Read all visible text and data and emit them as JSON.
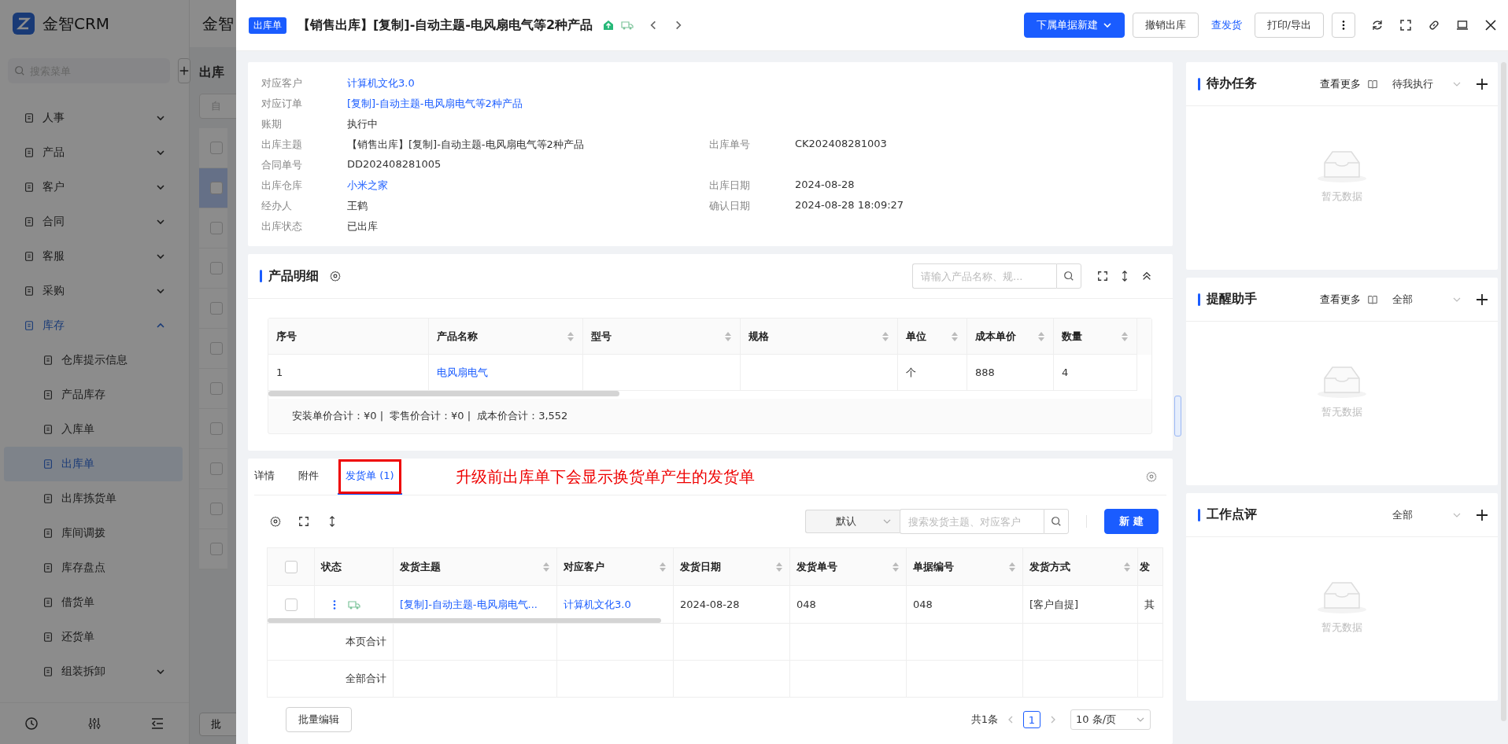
{
  "sidebar": {
    "brand": "金智CRM",
    "search_placeholder": "搜索菜单",
    "items": [
      {
        "label": "人事",
        "selected": false,
        "expanded": false
      },
      {
        "label": "产品",
        "selected": false,
        "expanded": false
      },
      {
        "label": "客户",
        "selected": false,
        "expanded": false
      },
      {
        "label": "合同",
        "selected": false,
        "expanded": false
      },
      {
        "label": "客服",
        "selected": false,
        "expanded": false
      },
      {
        "label": "采购",
        "selected": false,
        "expanded": false
      },
      {
        "label": "库存",
        "selected": true,
        "expanded": true,
        "children": [
          {
            "label": "仓库提示信息",
            "selected": false,
            "kind": "link"
          },
          {
            "label": "产品库存",
            "selected": false,
            "kind": "link"
          },
          {
            "label": "入库单",
            "selected": false,
            "kind": "link"
          },
          {
            "label": "出库单",
            "selected": true,
            "kind": "link"
          },
          {
            "label": "出库拣货单",
            "selected": false,
            "kind": "link"
          },
          {
            "label": "库间调拨",
            "selected": false,
            "kind": "link"
          },
          {
            "label": "库存盘点",
            "selected": false,
            "kind": "link"
          },
          {
            "label": "借货单",
            "selected": false,
            "kind": "link"
          },
          {
            "label": "还货单",
            "selected": false,
            "kind": "link"
          },
          {
            "label": "组装拆卸",
            "selected": false,
            "kind": "group",
            "expanded": false
          }
        ]
      }
    ]
  },
  "background_page": {
    "header": "金智",
    "page_title": "出库",
    "filter": "自",
    "batch_button": "批",
    "rows": [
      {
        "selected": false
      },
      {
        "selected": true
      },
      {
        "selected": false
      },
      {
        "selected": false
      },
      {
        "selected": false
      },
      {
        "selected": false
      },
      {
        "selected": false
      },
      {
        "selected": false
      },
      {
        "selected": false
      },
      {
        "selected": false
      },
      {
        "selected": false
      }
    ]
  },
  "drawer": {
    "tag": "出库单",
    "title": "【销售出库】[复制]-自动主题-电风扇电气等2种产品",
    "buttons": [
      {
        "label": "下属单据新建",
        "kind": "primary"
      },
      {
        "label": "撤销出库",
        "kind": "default"
      },
      {
        "label": "查发货",
        "kind": "link"
      },
      {
        "label": "打印/导出",
        "kind": "default"
      }
    ]
  },
  "details": [
    [
      {
        "label": "对应客户",
        "value": "计算机文化3.0",
        "link": true
      }
    ],
    [
      {
        "label": "对应订单",
        "value": "[复制]-自动主题-电风扇电气等2种产品",
        "link": true
      }
    ],
    [
      {
        "label": "账期",
        "value": "执行中",
        "link": false
      }
    ],
    [
      {
        "label": "出库主题",
        "value": "【销售出库】[复制]-自动主题-电风扇电气等2种产品",
        "link": false
      },
      {
        "label": "出库单号",
        "value": "CK202408281003",
        "link": false
      }
    ],
    [
      {
        "label": "合同单号",
        "value": "DD202408281005",
        "link": false
      }
    ],
    [
      {
        "label": "出库仓库",
        "value": "小米之家",
        "link": true
      },
      {
        "label": "出库日期",
        "value": "2024-08-28",
        "link": false
      }
    ],
    [
      {
        "label": "经办人",
        "value": "王鹤",
        "link": false
      },
      {
        "label": "确认日期",
        "value": "2024-08-28 18:09:27",
        "link": false
      }
    ],
    [
      {
        "label": "出库状态",
        "value": "已出库",
        "link": false
      }
    ]
  ],
  "products": {
    "title": "产品明细",
    "search_placeholder": "请输入产品名称、规...",
    "columns": [
      "序号",
      "产品名称",
      "型号",
      "规格",
      "单位",
      "成本单价",
      "数量"
    ],
    "rows": [
      {
        "index": "1",
        "name": "电风扇电气",
        "unit": "个",
        "unit_cost": "888",
        "quantity": "4"
      }
    ],
    "totals": [
      "安装单价合计：¥0 |",
      "零售价合计：¥0 |",
      "成本价合计：3,552"
    ]
  },
  "tabs": [
    {
      "label": "详情",
      "selected": false,
      "annotated": false
    },
    {
      "label": "附件",
      "selected": false,
      "annotated": false
    },
    {
      "label": "发货单 (1)",
      "selected": true,
      "annotated": true
    }
  ],
  "annotation": "升级前出库单下会显示换货单产生的发货单",
  "shipments": {
    "view_select": "默认",
    "search_placeholder": "搜索发货主题、对应客户",
    "new_button": "新 建",
    "select_all_checked": false,
    "columns": [
      "状态",
      "发货主题",
      "对应客户",
      "发货日期",
      "发货单号",
      "单据编号",
      "发货方式",
      "发"
    ],
    "rows": [
      {
        "checked": false,
        "subject": "[复制]-自动主题-电风扇电气...",
        "customer": "计算机文化3.0",
        "date": "2024-08-28",
        "ship_no": "048",
        "doc_no": "048",
        "method": "[客户自提]",
        "column_9": "其"
      }
    ],
    "summary_rows": [
      "本页合计",
      "全部合计"
    ],
    "batch_button": "批量编辑",
    "total": "共1条",
    "pages": [
      {
        "label": "1",
        "selected": true
      }
    ],
    "page_size": "10 条/页"
  },
  "panels": [
    {
      "title": "待办任务",
      "more": "查看更多",
      "filter": "待我执行",
      "empty": "暂无数据"
    },
    {
      "title": "提醒助手",
      "more": "查看更多",
      "filter": "全部",
      "empty": "暂无数据"
    },
    {
      "title": "工作点评",
      "filter": "全部",
      "empty": "暂无数据"
    }
  ]
}
